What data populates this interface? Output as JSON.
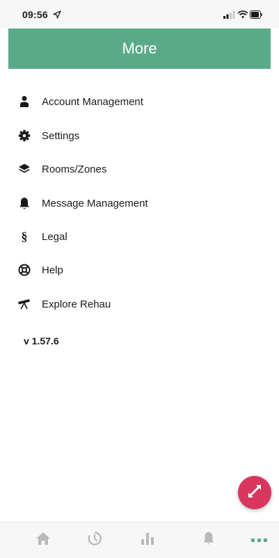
{
  "status_bar": {
    "time": "09:56",
    "icons": [
      "location-arrow-icon",
      "signal-icon",
      "wifi-icon",
      "battery-icon"
    ]
  },
  "header": {
    "title": "More",
    "background_color": "#5aaa8a"
  },
  "menu": {
    "items": [
      {
        "label": "Account Management",
        "icon": "person-icon"
      },
      {
        "label": "Settings",
        "icon": "gear-icon"
      },
      {
        "label": "Rooms/Zones",
        "icon": "layers-icon"
      },
      {
        "label": "Message Management",
        "icon": "bell-icon"
      },
      {
        "label": "Legal",
        "icon": "section-sign-icon",
        "icon_glyph": "§"
      },
      {
        "label": "Help",
        "icon": "lifebuoy-icon"
      },
      {
        "label": "Explore Rehau",
        "icon": "telescope-icon"
      }
    ]
  },
  "version": "v 1.57.6",
  "fab": {
    "icon": "swap-arrows-icon",
    "color": "#d9365f"
  },
  "tab_bar": {
    "tabs": [
      {
        "name": "home",
        "icon": "home-icon"
      },
      {
        "name": "timer",
        "icon": "timer-icon"
      },
      {
        "name": "statistics",
        "icon": "bar-chart-icon"
      },
      {
        "name": "notifications",
        "icon": "bell-icon"
      },
      {
        "name": "more",
        "icon": "more-dots-icon",
        "active": true
      }
    ],
    "active_color": "#5aaa8a",
    "inactive_color": "#b9b9b9"
  }
}
